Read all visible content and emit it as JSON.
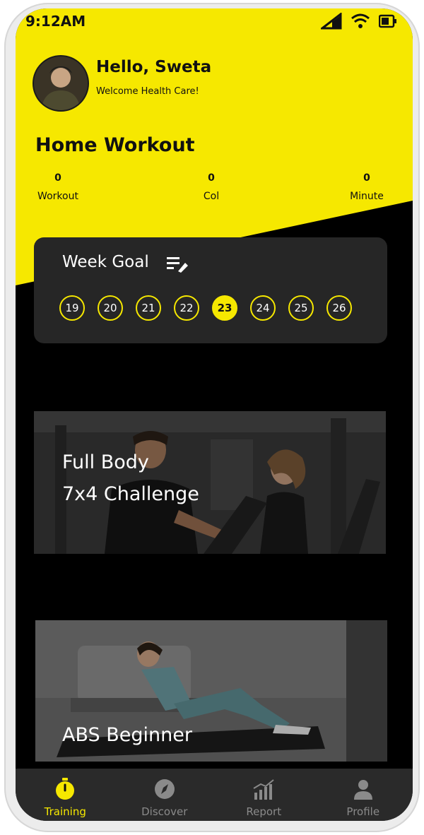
{
  "status_bar": {
    "time": "9:12AM"
  },
  "user": {
    "greeting": "Hello, Sweta",
    "subtitle": "Welcome Health Care!"
  },
  "home": {
    "title": "Home Workout",
    "stats": [
      {
        "value": "0",
        "label": "Workout"
      },
      {
        "value": "0",
        "label": "Col"
      },
      {
        "value": "0",
        "label": "Minute"
      }
    ]
  },
  "week_goal": {
    "title": "Week Goal",
    "days": [
      "19",
      "20",
      "21",
      "22",
      "23",
      "24",
      "25",
      "26"
    ],
    "selected_day": "23"
  },
  "workouts": [
    {
      "line1": "Full Body",
      "line2": "7x4 Challenge"
    },
    {
      "line1": "ABS Beginner"
    }
  ],
  "nav": {
    "items": [
      {
        "label": "Training",
        "icon": "stopwatch-icon",
        "active": true
      },
      {
        "label": "Discover",
        "icon": "compass-icon",
        "active": false
      },
      {
        "label": "Report",
        "icon": "chart-icon",
        "active": false
      },
      {
        "label": "Profile",
        "icon": "person-icon",
        "active": false
      }
    ]
  },
  "colors": {
    "accent": "#f6e800",
    "card": "#262626",
    "nav": "#2a2a2a"
  }
}
